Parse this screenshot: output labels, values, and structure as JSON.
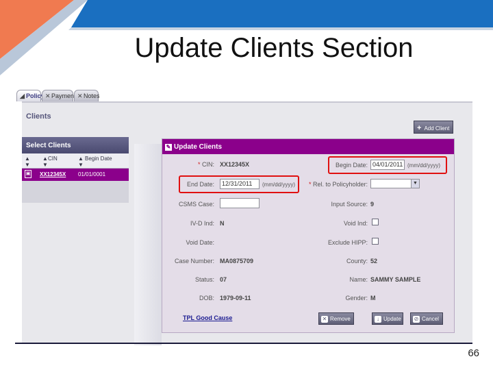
{
  "slide": {
    "title": "Update Clients Section",
    "page_number": "66"
  },
  "tabs": [
    {
      "label": "Policy",
      "active": true
    },
    {
      "label": "Payment",
      "active": false
    },
    {
      "label": "Notes",
      "active": false
    }
  ],
  "clients_section": {
    "label": "Clients",
    "add_button": "Add Client"
  },
  "select_clients": {
    "header": "Select Clients",
    "columns": [
      "CIN",
      "Begin Date"
    ],
    "rows": [
      {
        "cin": "XX12345X",
        "begin_date": "01/01/0001"
      }
    ]
  },
  "update_clients": {
    "header": "Update Clients",
    "left_fields": {
      "cin": {
        "label": "CIN:",
        "value": "XX12345X"
      },
      "end_date": {
        "label": "End Date:",
        "value": "12/31/2011",
        "format": "(mm/dd/yyyy)"
      },
      "csms_case": {
        "label": "CSMS Case:",
        "value": ""
      },
      "ivd_ind": {
        "label": "IV-D Ind:",
        "value": "N"
      },
      "void_date": {
        "label": "Void Date:",
        "value": ""
      },
      "case_number": {
        "label": "Case Number:",
        "value": "MA0875709"
      },
      "status": {
        "label": "Status:",
        "value": "07"
      },
      "dob": {
        "label": "DOB:",
        "value": "1979-09-11"
      }
    },
    "right_fields": {
      "begin_date": {
        "label": "Begin Date:",
        "value": "04/01/2011",
        "format": "(mm/dd/yyyy)"
      },
      "rel_policyholder": {
        "label": "Rel. to Policyholder:",
        "value": ""
      },
      "input_source": {
        "label": "Input Source:",
        "value": "9"
      },
      "void_ind": {
        "label": "Void Ind:"
      },
      "exclude_hipp": {
        "label": "Exclude HIPP:"
      },
      "county": {
        "label": "County:",
        "value": "52"
      },
      "name": {
        "label": "Name:",
        "value": "SAMMY SAMPLE"
      },
      "gender": {
        "label": "Gender:",
        "value": "M"
      }
    },
    "tpl_link": "TPL Good Cause",
    "buttons": {
      "remove": "Remove",
      "update": "Update",
      "cancel": "Cancel"
    }
  },
  "colors": {
    "accent": "#8b008b",
    "highlight": "#e01010",
    "header_blue": "#1a6fc0"
  }
}
